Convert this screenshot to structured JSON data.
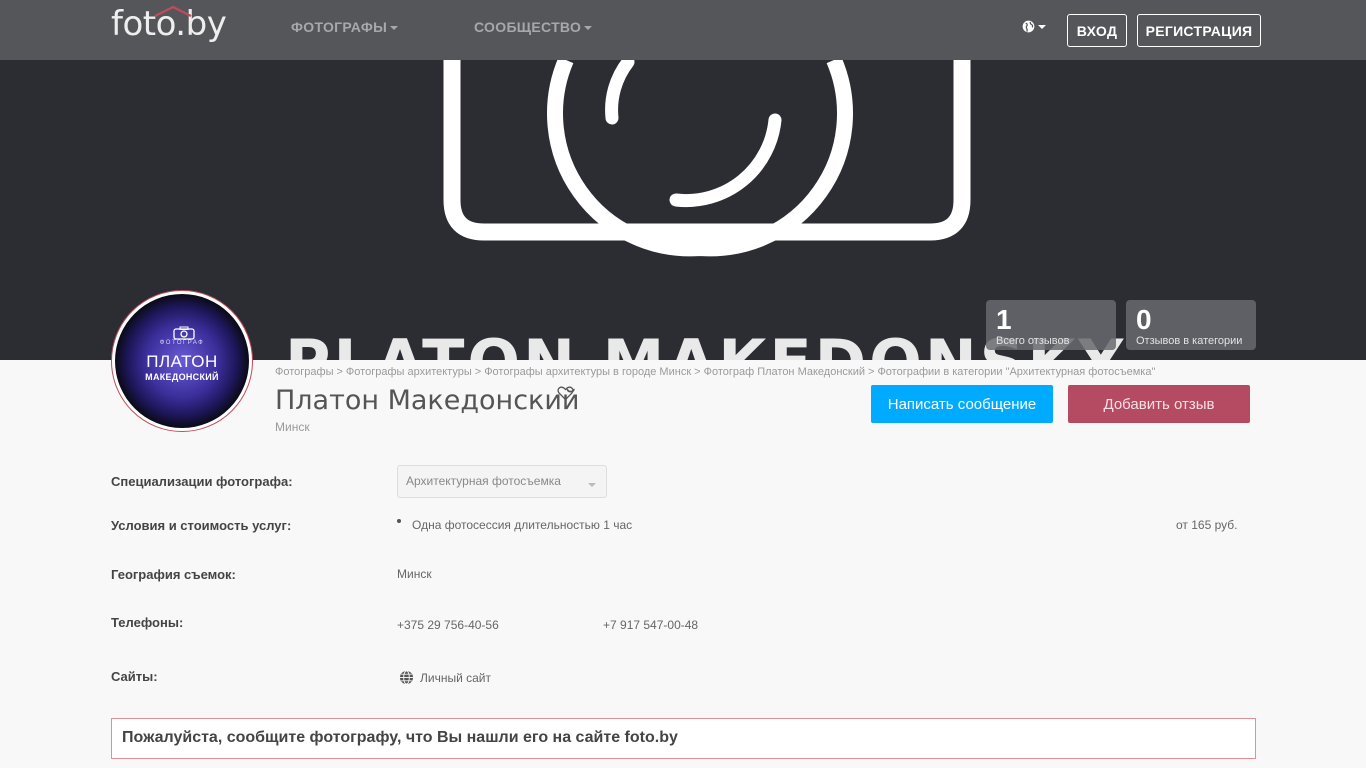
{
  "nav": {
    "logo": "foto.by",
    "menu": [
      {
        "label": "ФОТОГРАФЫ"
      },
      {
        "label": "СООБЩЕСТВО"
      }
    ],
    "login": "ВХОД",
    "register": "РЕГИСТРАЦИЯ"
  },
  "hero": {
    "banner_text": "PLATON MAKEDONSKY"
  },
  "stats": [
    {
      "value": "1",
      "label": "Всего отзывов"
    },
    {
      "value": "0",
      "label": "Отзывов в категории"
    }
  ],
  "avatar": {
    "top_text": "ФОТОГРАФ",
    "name_line1": "ПЛАТОН",
    "name_line2": "МАКЕДОНСКИЙ"
  },
  "breadcrumb": [
    "Фотографы",
    "Фотографы архитектуры",
    "Фотографы архитектуры в городе Минск",
    "Фотограф Платон Македонский",
    "Фотографии в категории \"Архитектурная фотосъемка\""
  ],
  "breadcrumb_separator": ">",
  "profile": {
    "name": "Платон Македонский",
    "city": "Минск",
    "message_button": "Написать сообщение",
    "review_button": "Добавить отзыв"
  },
  "details": {
    "specializations_label": "Специализации фотографа:",
    "specialization_selected": "Архитектурная фотосъемка",
    "services_label": "Условия и стоимость услуг:",
    "service_name": "Одна фотосессия длительностью 1 час",
    "service_price": "от 165 руб.",
    "geography_label": "География съемок:",
    "geography_value": "Минск",
    "phones_label": "Телефоны:",
    "phones": [
      "+375 29 756-40-56",
      "+7 917 547-00-48"
    ],
    "sites_label": "Сайты:",
    "site_link": "Личный сайт"
  },
  "notice": "Пожалуйста, сообщите фотографу, что Вы нашли его на сайте foto.by",
  "colors": {
    "nav_bg": "#55565a",
    "hero_bg": "#2c2d33",
    "message_button": "#00aaff",
    "review_button": "#b44b62",
    "notice_border": "#e08f9a"
  }
}
